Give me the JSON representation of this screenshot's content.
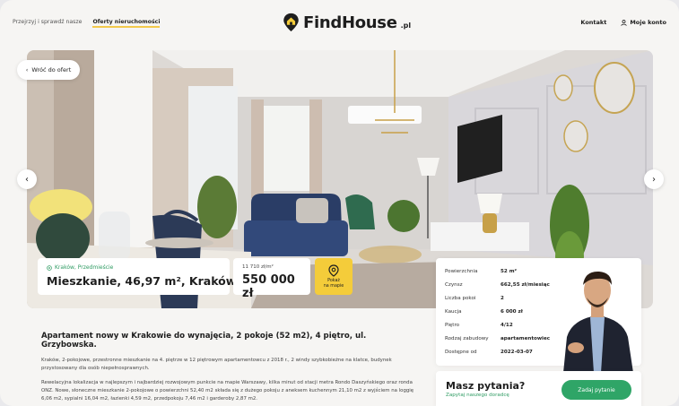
{
  "header": {
    "nav_left": [
      "Przejrzyj i sprawdź nasze",
      "Oferty nieruchomości"
    ],
    "logo_text": "FindHouse",
    "logo_tld": ".pl",
    "nav_right": {
      "contact": "Kontakt",
      "account": "Moje konto"
    }
  },
  "hero": {
    "back_label": "Wróć do ofert",
    "location": "Kraków, Przedmieście",
    "title": "Mieszkanie, 46,97 m², Kraków",
    "price_per_m2": "11 710 zł/m²",
    "price": "550 000 zł",
    "map_label_line1": "Pokaż",
    "map_label_line2": "na mapie"
  },
  "details": [
    {
      "label": "Powierzchnia",
      "value": "52 m²"
    },
    {
      "label": "Czynsz",
      "value": "662,55 zł/miesiąc"
    },
    {
      "label": "Liczba pokoi",
      "value": "2"
    },
    {
      "label": "Kaucja",
      "value": "6 000 zł"
    },
    {
      "label": "Piętro",
      "value": "4/12"
    },
    {
      "label": "Rodzaj zabudowy",
      "value": "apartamentowiec"
    },
    {
      "label": "Dostępne od",
      "value": "2022-03-07"
    }
  ],
  "description": {
    "heading": "Apartament nowy w Krakowie do wynajęcia, 2 pokoje (52 m2), 4 piętro, ul. Grzybowska.",
    "p1": "Kraków, 2-pokojowe, przestronne mieszkanie na 4. piętrze w 12 piętrowym apartamentowcu z 2018 r., 2 windy szybkobieżne na klatce, budynek przystosowany dla osób niepełnosprawnych.",
    "p2": "Rewelacyjna lokalizacja w najlepszym i najbardziej rozwojowym punkcie na mapie Warszawy, kilka minut od stacji metra Rondo Daszyńskiego oraz ronda ONZ. Nowe, słoneczne mieszkanie 2-pokojowe o powierzchni 52,40 m2 składa się z dużego pokoju z aneksem kuchennym 21,10 m2 z wyjściem na loggię 6,06 m2, sypialni 16,04 m2, łazienki 4,59 m2, przedpokoju 7,46 m2 i garderoby 2,87 m2."
  },
  "ask": {
    "title": "Masz pytania?",
    "subtitle": "Zapytaj naszego doradcę",
    "button": "Zadaj pytanie"
  },
  "colors": {
    "accent_green": "#2fa567",
    "accent_yellow": "#f4cc3a"
  },
  "icons": {
    "back": "chevron-left-icon",
    "prev": "chevron-left-icon",
    "next": "chevron-right-icon",
    "map": "map-pin-icon",
    "account": "user-icon",
    "location": "location-pin-icon"
  }
}
